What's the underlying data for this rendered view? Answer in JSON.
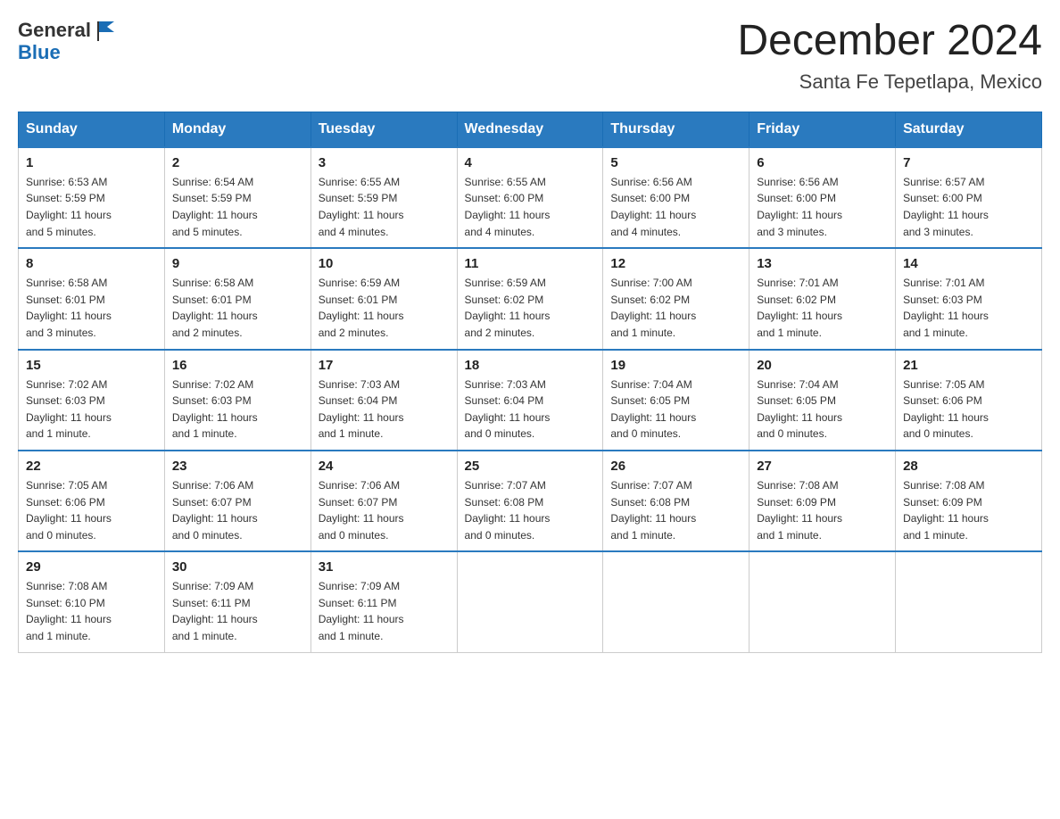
{
  "header": {
    "logo_general": "General",
    "logo_blue": "Blue",
    "title": "December 2024",
    "subtitle": "Santa Fe Tepetlapa, Mexico"
  },
  "days_of_week": [
    "Sunday",
    "Monday",
    "Tuesday",
    "Wednesday",
    "Thursday",
    "Friday",
    "Saturday"
  ],
  "weeks": [
    [
      {
        "day": "1",
        "sunrise": "6:53 AM",
        "sunset": "5:59 PM",
        "daylight": "11 hours and 5 minutes."
      },
      {
        "day": "2",
        "sunrise": "6:54 AM",
        "sunset": "5:59 PM",
        "daylight": "11 hours and 5 minutes."
      },
      {
        "day": "3",
        "sunrise": "6:55 AM",
        "sunset": "5:59 PM",
        "daylight": "11 hours and 4 minutes."
      },
      {
        "day": "4",
        "sunrise": "6:55 AM",
        "sunset": "6:00 PM",
        "daylight": "11 hours and 4 minutes."
      },
      {
        "day": "5",
        "sunrise": "6:56 AM",
        "sunset": "6:00 PM",
        "daylight": "11 hours and 4 minutes."
      },
      {
        "day": "6",
        "sunrise": "6:56 AM",
        "sunset": "6:00 PM",
        "daylight": "11 hours and 3 minutes."
      },
      {
        "day": "7",
        "sunrise": "6:57 AM",
        "sunset": "6:00 PM",
        "daylight": "11 hours and 3 minutes."
      }
    ],
    [
      {
        "day": "8",
        "sunrise": "6:58 AM",
        "sunset": "6:01 PM",
        "daylight": "11 hours and 3 minutes."
      },
      {
        "day": "9",
        "sunrise": "6:58 AM",
        "sunset": "6:01 PM",
        "daylight": "11 hours and 2 minutes."
      },
      {
        "day": "10",
        "sunrise": "6:59 AM",
        "sunset": "6:01 PM",
        "daylight": "11 hours and 2 minutes."
      },
      {
        "day": "11",
        "sunrise": "6:59 AM",
        "sunset": "6:02 PM",
        "daylight": "11 hours and 2 minutes."
      },
      {
        "day": "12",
        "sunrise": "7:00 AM",
        "sunset": "6:02 PM",
        "daylight": "11 hours and 1 minute."
      },
      {
        "day": "13",
        "sunrise": "7:01 AM",
        "sunset": "6:02 PM",
        "daylight": "11 hours and 1 minute."
      },
      {
        "day": "14",
        "sunrise": "7:01 AM",
        "sunset": "6:03 PM",
        "daylight": "11 hours and 1 minute."
      }
    ],
    [
      {
        "day": "15",
        "sunrise": "7:02 AM",
        "sunset": "6:03 PM",
        "daylight": "11 hours and 1 minute."
      },
      {
        "day": "16",
        "sunrise": "7:02 AM",
        "sunset": "6:03 PM",
        "daylight": "11 hours and 1 minute."
      },
      {
        "day": "17",
        "sunrise": "7:03 AM",
        "sunset": "6:04 PM",
        "daylight": "11 hours and 1 minute."
      },
      {
        "day": "18",
        "sunrise": "7:03 AM",
        "sunset": "6:04 PM",
        "daylight": "11 hours and 0 minutes."
      },
      {
        "day": "19",
        "sunrise": "7:04 AM",
        "sunset": "6:05 PM",
        "daylight": "11 hours and 0 minutes."
      },
      {
        "day": "20",
        "sunrise": "7:04 AM",
        "sunset": "6:05 PM",
        "daylight": "11 hours and 0 minutes."
      },
      {
        "day": "21",
        "sunrise": "7:05 AM",
        "sunset": "6:06 PM",
        "daylight": "11 hours and 0 minutes."
      }
    ],
    [
      {
        "day": "22",
        "sunrise": "7:05 AM",
        "sunset": "6:06 PM",
        "daylight": "11 hours and 0 minutes."
      },
      {
        "day": "23",
        "sunrise": "7:06 AM",
        "sunset": "6:07 PM",
        "daylight": "11 hours and 0 minutes."
      },
      {
        "day": "24",
        "sunrise": "7:06 AM",
        "sunset": "6:07 PM",
        "daylight": "11 hours and 0 minutes."
      },
      {
        "day": "25",
        "sunrise": "7:07 AM",
        "sunset": "6:08 PM",
        "daylight": "11 hours and 0 minutes."
      },
      {
        "day": "26",
        "sunrise": "7:07 AM",
        "sunset": "6:08 PM",
        "daylight": "11 hours and 1 minute."
      },
      {
        "day": "27",
        "sunrise": "7:08 AM",
        "sunset": "6:09 PM",
        "daylight": "11 hours and 1 minute."
      },
      {
        "day": "28",
        "sunrise": "7:08 AM",
        "sunset": "6:09 PM",
        "daylight": "11 hours and 1 minute."
      }
    ],
    [
      {
        "day": "29",
        "sunrise": "7:08 AM",
        "sunset": "6:10 PM",
        "daylight": "11 hours and 1 minute."
      },
      {
        "day": "30",
        "sunrise": "7:09 AM",
        "sunset": "6:11 PM",
        "daylight": "11 hours and 1 minute."
      },
      {
        "day": "31",
        "sunrise": "7:09 AM",
        "sunset": "6:11 PM",
        "daylight": "11 hours and 1 minute."
      },
      null,
      null,
      null,
      null
    ]
  ],
  "labels": {
    "sunrise": "Sunrise: ",
    "sunset": "Sunset: ",
    "daylight": "Daylight: "
  }
}
